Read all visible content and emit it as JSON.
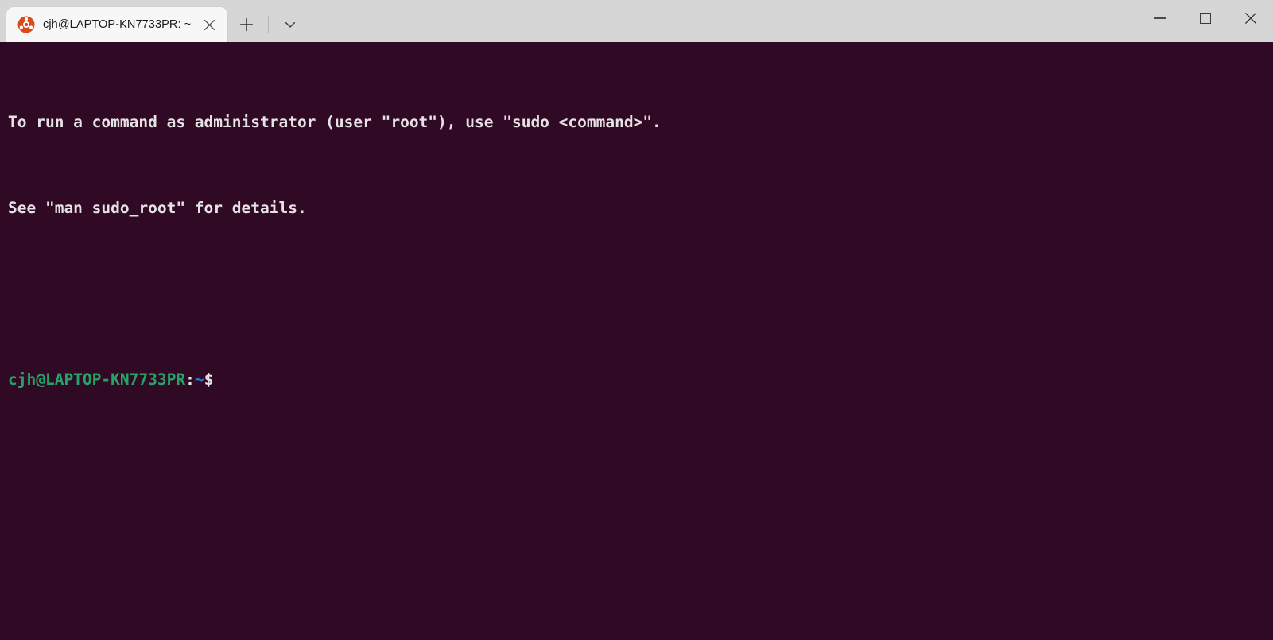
{
  "window": {
    "tab": {
      "title": "cjh@LAPTOP-KN7733PR: ~",
      "favicon_icon": "ubuntu-logo-icon",
      "close_icon": "close-icon"
    },
    "tabbar": {
      "new_tab_icon": "plus-icon",
      "tab_list_icon": "chevron-down-icon"
    },
    "controls": {
      "minimize_icon": "minimize-icon",
      "maximize_icon": "maximize-icon",
      "close_icon": "close-icon"
    },
    "colors": {
      "titlebar_bg": "#d6d6d6",
      "tab_bg": "#f7f7f7",
      "terminal_bg": "#300a24",
      "terminal_fg": "#e6e1e4",
      "prompt_green": "#26a269",
      "prompt_blue": "#2a7bde",
      "ubuntu_orange": "#dd4814"
    }
  },
  "terminal": {
    "lines": [
      {
        "type": "text",
        "text": "To run a command as administrator (user \"root\"), use \"sudo <command>\"."
      },
      {
        "type": "text",
        "text": "See \"man sudo_root\" for details."
      },
      {
        "type": "blank",
        "text": ""
      }
    ],
    "prompt": {
      "user_host": "cjh@LAPTOP-KN7733PR",
      "separator": ":",
      "path": "~",
      "sigil": "$",
      "command": ""
    }
  }
}
